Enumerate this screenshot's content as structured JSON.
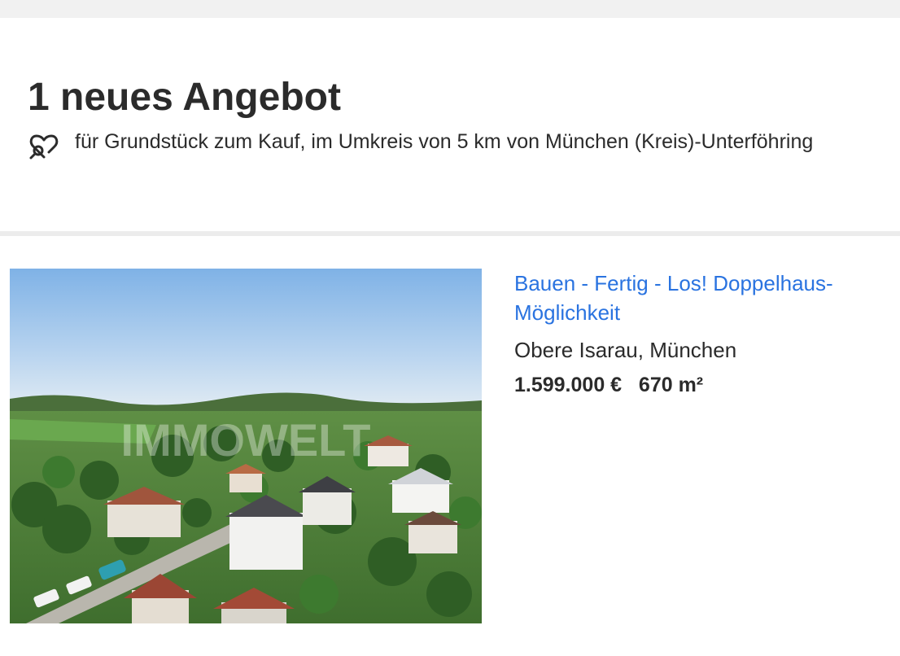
{
  "header": {
    "title": "1 neues Angebot",
    "search_description": "für  Grundstück zum Kauf, im Umkreis von 5 km von München (Kreis)-Unterföhring",
    "saved_search_icon": "heart-search-icon"
  },
  "listing": {
    "title": "Bauen - Fertig - Los! Doppelhaus-Möglichkeit",
    "location": "Obere Isarau, München",
    "price": "1.599.000 €",
    "area": "670 m²",
    "photo_watermark": "IMMOWELT",
    "photo_alt": "Luftbild einer Wohnsiedlung"
  },
  "colors": {
    "link": "#2a73e0",
    "text": "#2b2b2b",
    "divider": "#ececec"
  }
}
